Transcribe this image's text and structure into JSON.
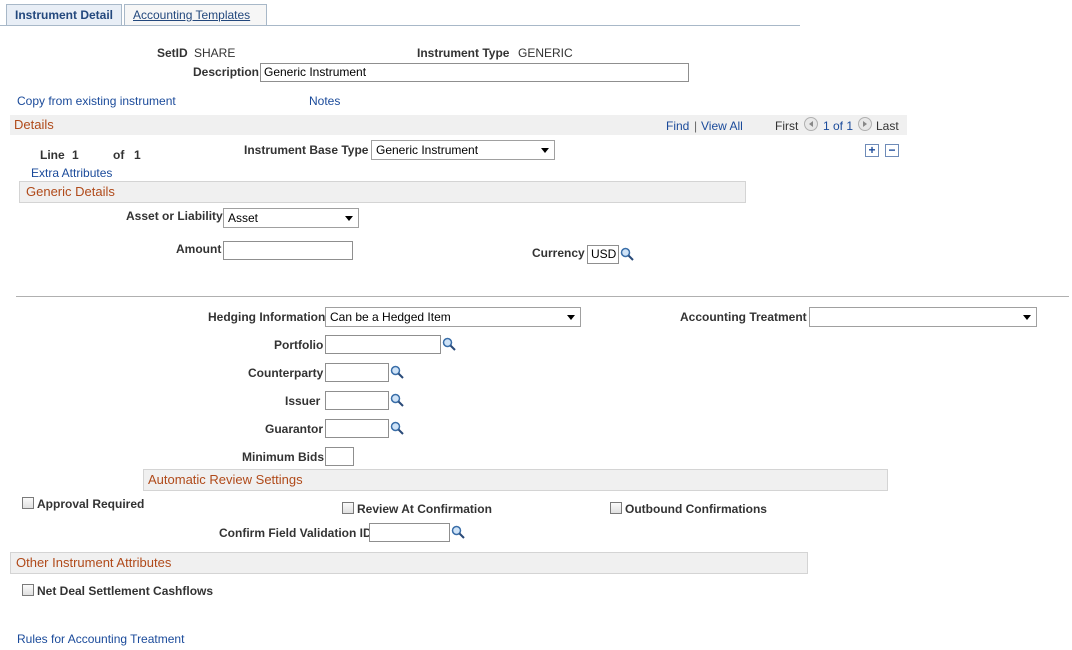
{
  "tabs": [
    {
      "label": "Instrument Detail"
    },
    {
      "label": "Accounting Templates"
    }
  ],
  "header": {
    "setid_label": "SetID",
    "setid_value": "SHARE",
    "instrument_type_label": "Instrument Type",
    "instrument_type_value": "GENERIC",
    "description_label": "Description",
    "description_value": "Generic Instrument"
  },
  "links": {
    "copy_from": "Copy from existing instrument",
    "notes": "Notes",
    "extra_attributes": "Extra Attributes",
    "rules": "Rules for Accounting Treatment"
  },
  "details": {
    "title": "Details",
    "find": "Find",
    "separator": "|",
    "view_all": "View All",
    "first": "First",
    "pager": "1 of 1",
    "last": "Last",
    "line_label": "Line",
    "line_value": "1",
    "of_label": "of",
    "of_value": "1",
    "base_type_label": "Instrument Base Type",
    "base_type_value": "Generic Instrument"
  },
  "generic": {
    "title": "Generic Details",
    "asset_label": "Asset or Liability",
    "asset_value": "Asset",
    "amount_label": "Amount",
    "amount_value": "",
    "currency_label": "Currency",
    "currency_value": "USD"
  },
  "hedging": {
    "hedging_label": "Hedging Information",
    "hedging_value": "Can be a Hedged Item",
    "treatment_label": "Accounting Treatment",
    "treatment_value": "",
    "portfolio_label": "Portfolio",
    "counterparty_label": "Counterparty",
    "issuer_label": "Issuer",
    "guarantor_label": "Guarantor",
    "min_bids_label": "Minimum Bids"
  },
  "review": {
    "title": "Automatic Review Settings",
    "approval_label": "Approval Required",
    "review_label": "Review At Confirmation",
    "outbound_label": "Outbound Confirmations",
    "confirm_label": "Confirm Field Validation ID"
  },
  "other": {
    "title": "Other Instrument Attributes",
    "net_label": "Net Deal Settlement Cashflows"
  },
  "colors": {
    "link": "#1a4a9a",
    "section_title": "#b04a1a",
    "tab_active_bg": "#e8eef6"
  }
}
